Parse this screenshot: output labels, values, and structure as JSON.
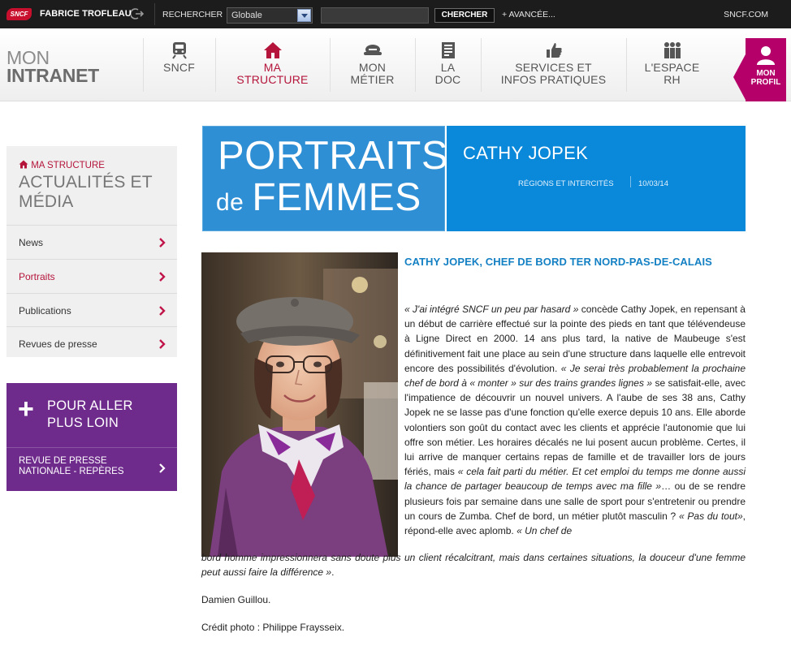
{
  "topbar": {
    "logo": "SNCF",
    "user_name": "FABRICE TROFLEAU",
    "search_label": "RECHERCHER",
    "scope_value": "Globale",
    "search_button": "CHERCHER",
    "advanced_link": "+ AVANCÉE...",
    "external_link": "SNCF.COM"
  },
  "nav": {
    "brand_line1": "MON",
    "brand_line2": "INTRANET",
    "items": [
      {
        "label_line1": "SNCF",
        "label_line2": "",
        "icon": "train-icon"
      },
      {
        "label_line1": "MA",
        "label_line2": "STRUCTURE",
        "icon": "home-icon",
        "active": true
      },
      {
        "label_line1": "MON",
        "label_line2": "MÉTIER",
        "icon": "cap-icon"
      },
      {
        "label_line1": "LA",
        "label_line2": "DOC",
        "icon": "document-icon"
      },
      {
        "label_line1": "SERVICES ET",
        "label_line2": "INFOS PRATIQUES",
        "icon": "thumbs-up-icon"
      },
      {
        "label_line1": "L'ESPACE",
        "label_line2": "RH",
        "icon": "people-icon"
      }
    ],
    "profile_line1": "MON",
    "profile_line2": "PROFIL",
    "accent": "#b5006a"
  },
  "sidebar": {
    "crumb": "MA STRUCTURE",
    "section_line1": "ACTUALITÉS ET",
    "section_line2": "MÉDIA",
    "items": [
      {
        "label": "News"
      },
      {
        "label": "Portraits"
      },
      {
        "label": "Publications"
      },
      {
        "label": "Revues de presse"
      }
    ],
    "promo_line1": "POUR ALLER",
    "promo_line2": "PLUS LOIN",
    "promo_link_line1": "REVUE DE PRESSE",
    "promo_link_line2": "NATIONALE - REPÈRES",
    "promo_color": "#6e2b8c"
  },
  "banner": {
    "line1": "PORTRAITS",
    "line2_small": "de",
    "line2_big": "FEMMES",
    "name": "CATHY JOPEK",
    "category": "RÉGIONS ET INTERCITÉS",
    "date": "10/03/14",
    "color": "#0a88d9"
  },
  "article": {
    "title": "CATHY JOPEK, CHEF DE BORD TER NORD-PAS-DE-CALAIS",
    "p1_italic_a": "« J'ai intégré SNCF un peu par hasard »",
    "p1_text_a": " concède Cathy Jopek, en repensant à un début de carrière effectué sur la pointe des pieds en tant que télévendeuse à Ligne Direct en 2000. 14 ans plus tard, la native de Maubeuge s'est définitivement fait une place au sein d'une structure dans laquelle elle entrevoit encore des possibilités d'évolution. ",
    "p1_italic_b": "« Je serai très probablement la prochaine chef de bord à « monter » sur des trains grandes lignes »",
    "p1_text_b": " se satisfait-elle, avec l'impatience de découvrir un nouvel univers. A l'aube de ses 38 ans, Cathy Jopek ne se lasse pas d'une fonction qu'elle exerce depuis 10 ans. Elle aborde volontiers son goût du contact avec les clients et apprécie l'autonomie que lui offre son métier. Les horaires décalés ne lui posent aucun problème. Certes, il lui arrive de manquer certains repas de famille et de travailler lors de jours fériés, mais ",
    "p1_italic_c": "« cela fait parti du métier. Et cet emploi du temps me donne aussi la chance de partager beaucoup de temps avec ma fille »",
    "p1_text_c": "… ou de se rendre plusieurs fois par semaine dans une salle de sport pour s'entretenir ou prendre un cours de Zumba. Chef de bord, un métier plutôt masculin ? ",
    "p1_italic_d": "« Pas du tout»",
    "p1_text_d": ", répond-elle avec aplomb. ",
    "p1_italic_e": "« Un chef de",
    "tail": "bord homme impressionnera sans doute plus un client récalcitrant, mais dans certaines situations, la douceur d'une femme peut aussi faire la différence »",
    "tail_end": ".",
    "author": "Damien Guillou.",
    "credit": "Crédit photo : Philippe Fraysseix."
  }
}
